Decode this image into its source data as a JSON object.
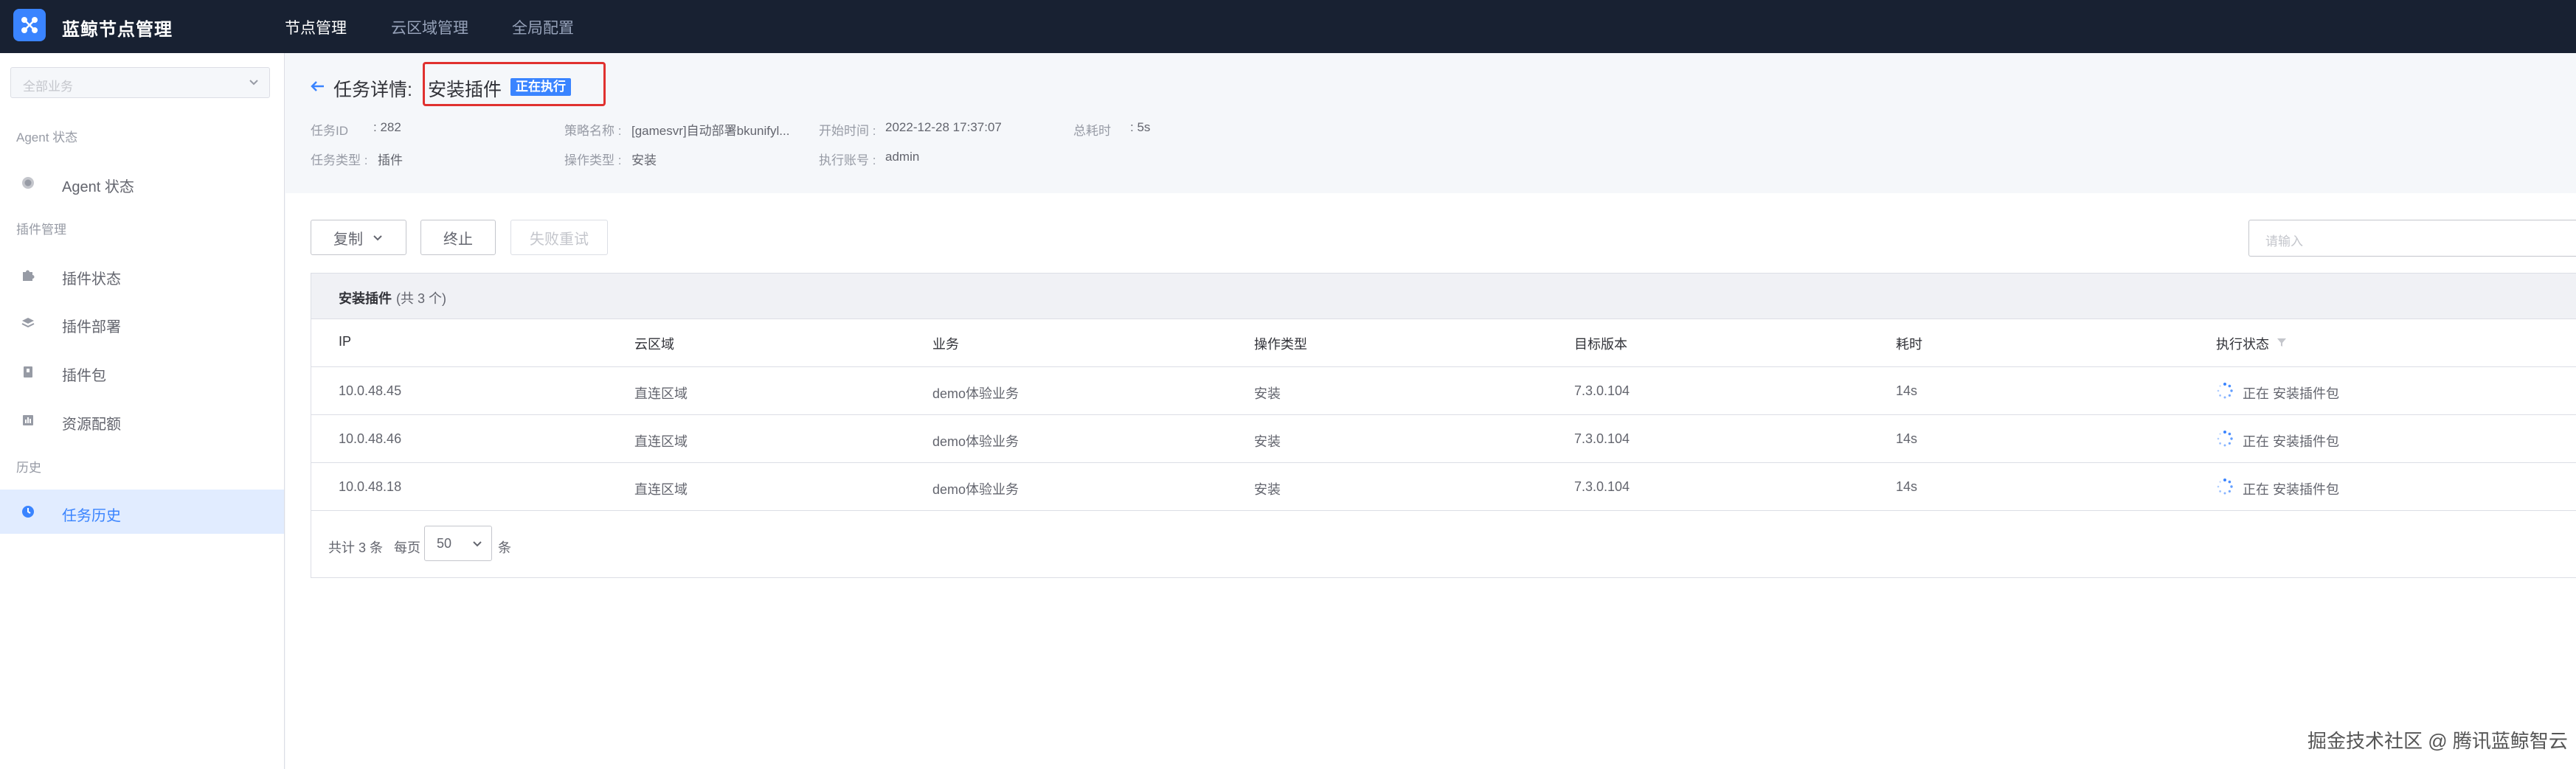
{
  "app": {
    "title": "蓝鲸节点管理"
  },
  "topnav": {
    "items": [
      "节点管理",
      "云区域管理",
      "全局配置"
    ]
  },
  "sidebar": {
    "business_placeholder": "全部业务",
    "groups": {
      "agent": "Agent 状态",
      "plugin": "插件管理",
      "history": "历史"
    },
    "items": [
      {
        "label": "Agent 状态",
        "icon": "agent-status-icon"
      },
      {
        "label": "插件状态",
        "icon": "puzzle-icon"
      },
      {
        "label": "插件部署",
        "icon": "layers-icon"
      },
      {
        "label": "插件包",
        "icon": "package-icon"
      },
      {
        "label": "资源配额",
        "icon": "quota-icon"
      },
      {
        "label": "任务历史",
        "icon": "clock-icon"
      }
    ]
  },
  "detail": {
    "title": "任务详情:",
    "task_name": "安装插件",
    "status": "正在执行",
    "meta": [
      {
        "label": "任务ID",
        "value": ": 282"
      },
      {
        "label": "任务类型 :",
        "value": "插件"
      },
      {
        "label": "策略名称 :",
        "value": "[gamesvr]自动部署bkunifyl..."
      },
      {
        "label": "操作类型 :",
        "value": "安装"
      },
      {
        "label": "开始时间 :",
        "value": "2022-12-28 17:37:07"
      },
      {
        "label": "执行账号 :",
        "value": "admin"
      },
      {
        "label": "总耗时",
        "value": ": 5s"
      }
    ]
  },
  "toolbar": {
    "copy": "复制",
    "stop": "终止",
    "retry": "失败重试",
    "search_placeholder": "请输入"
  },
  "table": {
    "title": "安装插件",
    "count_text": "(共 3 个)",
    "columns": [
      "IP",
      "云区域",
      "业务",
      "操作类型",
      "目标版本",
      "耗时",
      "执行状态"
    ],
    "rows": [
      {
        "ip": "10.0.48.45",
        "cloud": "直连区域",
        "biz": "demo体验业务",
        "op": "安装",
        "version": "7.3.0.104",
        "cost": "14s",
        "status": "正在 安装插件包"
      },
      {
        "ip": "10.0.48.46",
        "cloud": "直连区域",
        "biz": "demo体验业务",
        "op": "安装",
        "version": "7.3.0.104",
        "cost": "14s",
        "status": "正在 安装插件包"
      },
      {
        "ip": "10.0.48.18",
        "cloud": "直连区域",
        "biz": "demo体验业务",
        "op": "安装",
        "version": "7.3.0.104",
        "cost": "14s",
        "status": "正在 安装插件包"
      }
    ],
    "pager": {
      "total": "共计 3 条",
      "per_page": "每页",
      "page_size": "50",
      "unit": "条"
    }
  },
  "watermark": "掘金技术社区 @ 腾讯蓝鲸智云",
  "colors": {
    "accent": "#3a84ff",
    "topbar": "#182132",
    "highlight": "#e0312f"
  }
}
